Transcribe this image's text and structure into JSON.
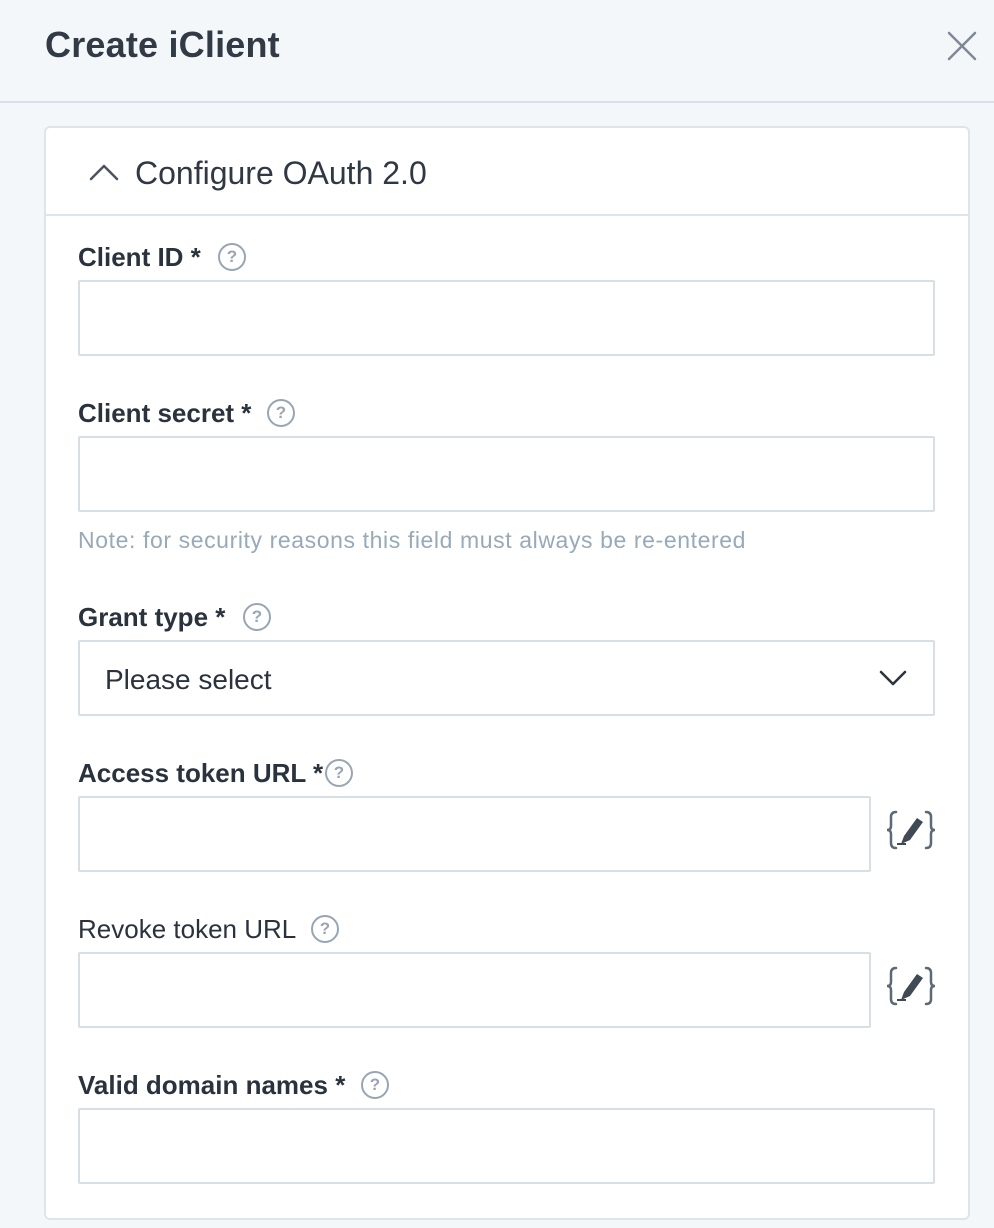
{
  "header": {
    "title": "Create iClient"
  },
  "section": {
    "title": "Configure OAuth 2.0"
  },
  "fields": {
    "client_id": {
      "label": "Client ID *",
      "value": "",
      "help": "?"
    },
    "client_secret": {
      "label": "Client secret *",
      "value": "",
      "help": "?",
      "note": "Note: for security reasons this field must always be re-entered"
    },
    "grant_type": {
      "label": "Grant type *",
      "selected": "Please select",
      "help": "?"
    },
    "access_token_url": {
      "label": "Access token URL *",
      "value": "",
      "help": "?"
    },
    "revoke_token_url": {
      "label": "Revoke token URL",
      "value": "",
      "help": "?"
    },
    "valid_domain_names": {
      "label": "Valid domain names *",
      "value": "",
      "help": "?"
    }
  },
  "icons": {
    "close": "close-icon",
    "collapse": "chevron-up-icon",
    "dropdown": "chevron-down-icon",
    "help": "help-icon",
    "variable": "variable-editor-icon"
  },
  "colors": {
    "background": "#f4f7fa",
    "border": "#d6dfe6",
    "icon": "#7d8a96",
    "note": "#98a9b7",
    "text": "#2a333d"
  }
}
